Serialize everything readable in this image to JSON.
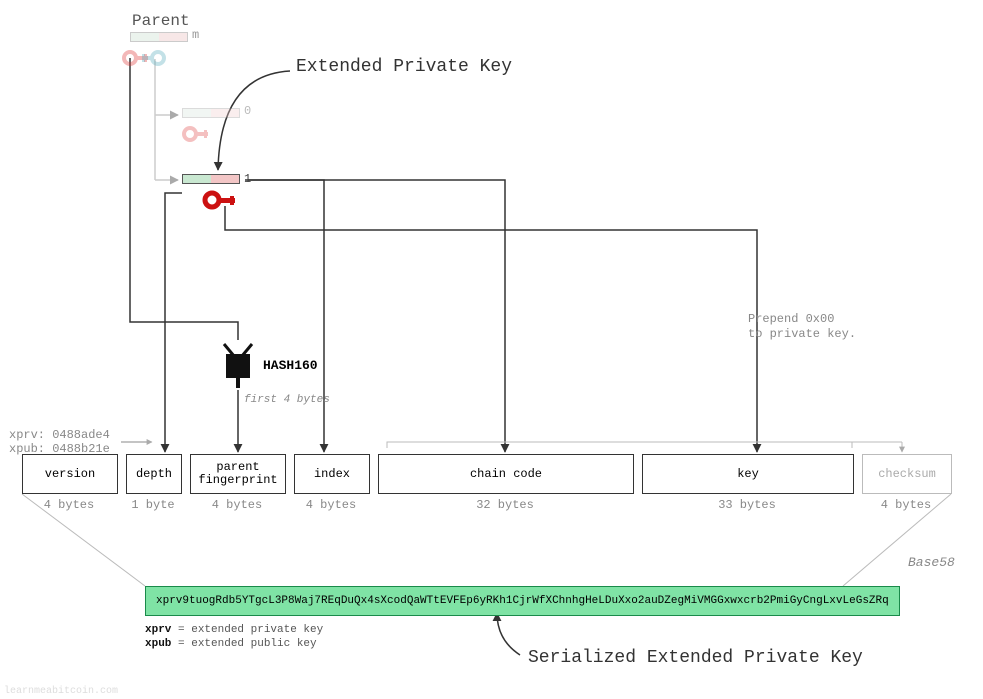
{
  "labels": {
    "parent": "Parent",
    "title_epk": "Extended Private Key",
    "title_sepk": "Serialized Extended Private Key",
    "hash160": "HASH160",
    "first4": "first 4 bytes",
    "prepend": "Prepend 0x00\nto private key.",
    "base58": "Base58",
    "xprv_prefix": "xprv: 0488ade4",
    "xpub_prefix": "xpub: 0488b21e",
    "node_m": "m",
    "node_0": "0",
    "node_1": "1",
    "watermark": "learnmeabitcoin.com"
  },
  "fields": [
    {
      "name": "version",
      "size": "4 bytes"
    },
    {
      "name": "depth",
      "size": "1 byte"
    },
    {
      "name": "parent\nfingerprint",
      "size": "4 bytes"
    },
    {
      "name": "index",
      "size": "4 bytes"
    },
    {
      "name": "chain code",
      "size": "32 bytes"
    },
    {
      "name": "key",
      "size": "33 bytes"
    },
    {
      "name": "checksum",
      "size": "4 bytes"
    }
  ],
  "serialized": "xprv9tuogRdb5YTgcL3P8Waj7REqDuQx4sXcodQaWTtEVFEp6yRKh1CjrWfXChnhgHeLDuXxo2auDZegMiVMGGxwxcrb2PmiGyCngLxvLeGsZRq",
  "legend": {
    "xprv": "= extended private key",
    "xpub": "= extended public key"
  }
}
